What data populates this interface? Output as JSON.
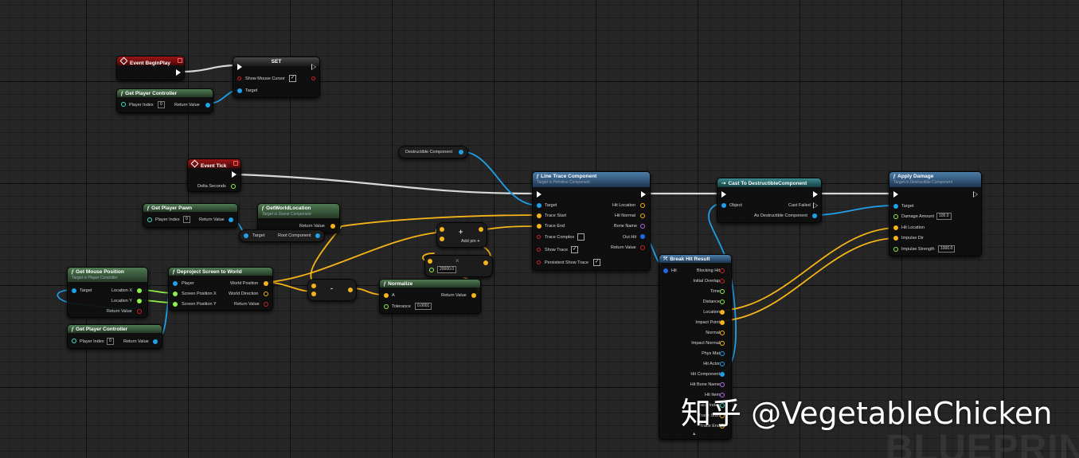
{
  "watermark": "知乎 @VegetableChicken",
  "corner_text": "BLUEPRINT",
  "nodes": {
    "begin_play": {
      "title": "Event BeginPlay"
    },
    "set": {
      "title": "SET",
      "show_mouse_cursor": "Show Mouse Cursor",
      "target": "Target"
    },
    "get_pc_1": {
      "title": "Get Player Controller",
      "player_index": "Player Index",
      "index_value": "0",
      "return_value": "Return Value"
    },
    "destructible": {
      "title": "Destructible Component"
    },
    "event_tick": {
      "title": "Event Tick",
      "delta": "Delta Seconds"
    },
    "get_pawn": {
      "title": "Get Player Pawn",
      "player_index": "Player Index",
      "index_value": "0",
      "return_value": "Return Value"
    },
    "world_loc": {
      "title": "GetWorldLocation",
      "subtitle": "Target is Scene Component",
      "return_value": "Return Value"
    },
    "root_comp": {
      "target": "Target",
      "root": "Root Component"
    },
    "add": {
      "title": "+",
      "add_pin": "Add pin"
    },
    "multiply": {
      "title": "×",
      "value": "20000.0"
    },
    "subtract": {
      "title": "-"
    },
    "normalize": {
      "title": "Normalize",
      "a": "A",
      "tolerance": "Tolerance",
      "tolerance_value": "0.0001",
      "return_value": "Return Value"
    },
    "mouse_pos": {
      "title": "Get Mouse Position",
      "subtitle": "Target is Player Controller",
      "target": "Target",
      "loc_x": "Location X",
      "loc_y": "Location Y",
      "return_value": "Return Value"
    },
    "get_pc_2": {
      "title": "Get Player Controller",
      "player_index": "Player Index",
      "index_value": "0",
      "return_value": "Return Value"
    },
    "deproject": {
      "title": "Deproject Screen to World",
      "player": "Player",
      "screen_x": "Screen Position X",
      "screen_y": "Screen Position Y",
      "world_pos": "World Position",
      "world_dir": "World Direction",
      "return_value": "Return Value"
    },
    "line_trace": {
      "title": "Line Trace Component",
      "subtitle": "Target is Primitive Component",
      "target": "Target",
      "trace_start": "Trace Start",
      "trace_end": "Trace End",
      "trace_complex": "Trace Complex",
      "show_trace": "Show Trace",
      "persistent": "Persistent Show Trace",
      "hit_location": "Hit Location",
      "hit_normal": "Hit Normal",
      "bone_name": "Bone Name",
      "out_hit": "Out Hit",
      "return_value": "Return Value"
    },
    "cast": {
      "title": "Cast To DestructibleComponent",
      "object": "Object",
      "cast_failed": "Cast Failed",
      "as_destructible": "As Destructible Component"
    },
    "apply_damage": {
      "title": "Apply Damage",
      "subtitle": "Target is Destructible Component",
      "target": "Target",
      "damage_amount": "Damage Amount",
      "damage_value": "100.0",
      "hit_location": "Hit Location",
      "impulse_dir": "Impulse Dir",
      "impulse_strength": "Impulse Strength",
      "impulse_value": "1000.0"
    },
    "break_hit": {
      "title": "Break Hit Result",
      "hit": "Hit",
      "outputs": [
        "Blocking Hit",
        "Initial Overlap",
        "Time",
        "Distance",
        "Location",
        "Impact Point",
        "Normal",
        "Impact Normal",
        "Phys Mat",
        "Hit Actor",
        "Hit Component",
        "Hit Bone Name",
        "Hit Item",
        "Face Index",
        "Trace Start",
        "Trace End"
      ]
    }
  }
}
